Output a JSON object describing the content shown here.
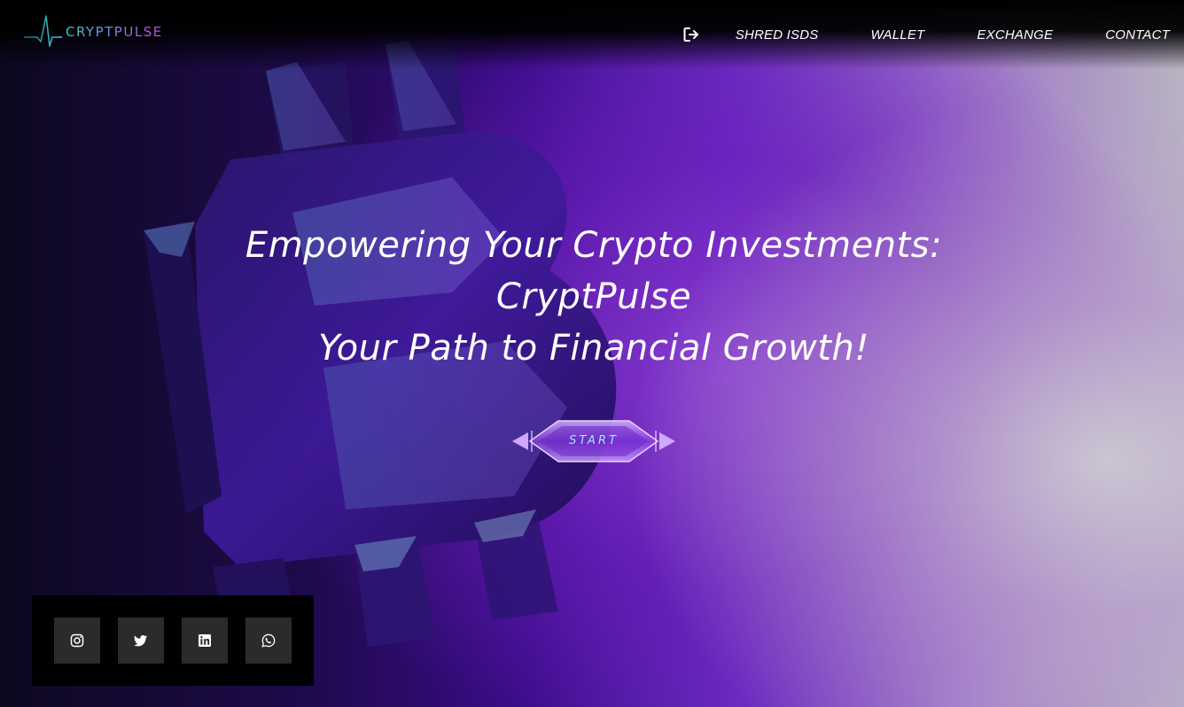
{
  "brand": {
    "name": "CRYPTPULSE",
    "logo_icon": "heartbeat-pulse-icon"
  },
  "nav": {
    "login_icon": "sign-in-icon",
    "items": [
      {
        "label": "SHRED ISDS"
      },
      {
        "label": "WALLET"
      },
      {
        "label": "EXCHANGE"
      },
      {
        "label": "CONTACT"
      }
    ]
  },
  "hero": {
    "line1": "Empowering Your Crypto Investments:",
    "line2": "CryptPulse",
    "line3": "Your Path to Financial Growth!",
    "cta_label": "START"
  },
  "social": [
    {
      "name": "instagram",
      "icon": "instagram-icon"
    },
    {
      "name": "twitter",
      "icon": "twitter-icon"
    },
    {
      "name": "linkedin",
      "icon": "linkedin-icon"
    },
    {
      "name": "whatsapp",
      "icon": "whatsapp-icon"
    }
  ],
  "colors": {
    "accent_cyan": "#35c9d6",
    "accent_magenta": "#c04ad8",
    "cta_text": "#9ce8ff",
    "social_bg": "#2b2b2b"
  }
}
